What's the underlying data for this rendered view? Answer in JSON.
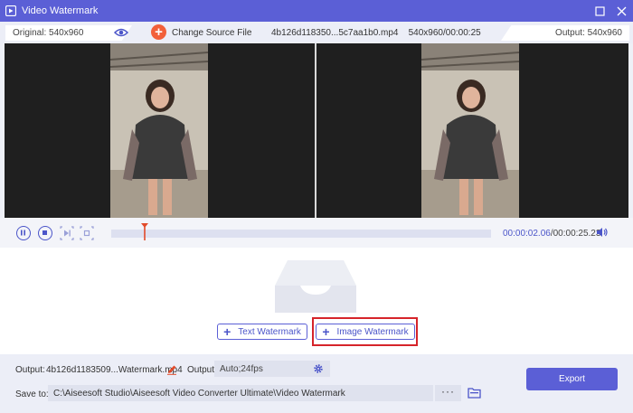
{
  "window": {
    "title": "Video Watermark"
  },
  "infobar": {
    "original_label": "Original: 540x960",
    "change_source_label": "Change Source File",
    "file_name": "4b126d118350...5c7aa1b0.mp4",
    "file_info": "540x960/00:00:25",
    "output_label": "Output: 540x960"
  },
  "playback": {
    "current_time": "00:00:02.06",
    "total_time": "/00:00:25.23",
    "progress_fraction": 0.085
  },
  "watermark": {
    "text_button": "Text Watermark",
    "image_button": "Image Watermark"
  },
  "bottom": {
    "output_label": "Output:",
    "output_file": "4b126d1183509...Watermark.mp4",
    "format_label": "Output:",
    "format_value": "Auto;24fps",
    "save_label": "Save to:",
    "save_path": "C:\\Aiseesoft Studio\\Aiseesoft Video Converter Ultimate\\Video Watermark",
    "browse_label": "···",
    "export_label": "Export"
  },
  "colors": {
    "accent": "#5b5fd6",
    "highlight": "#d6242a",
    "change_source": "#f2603a"
  }
}
